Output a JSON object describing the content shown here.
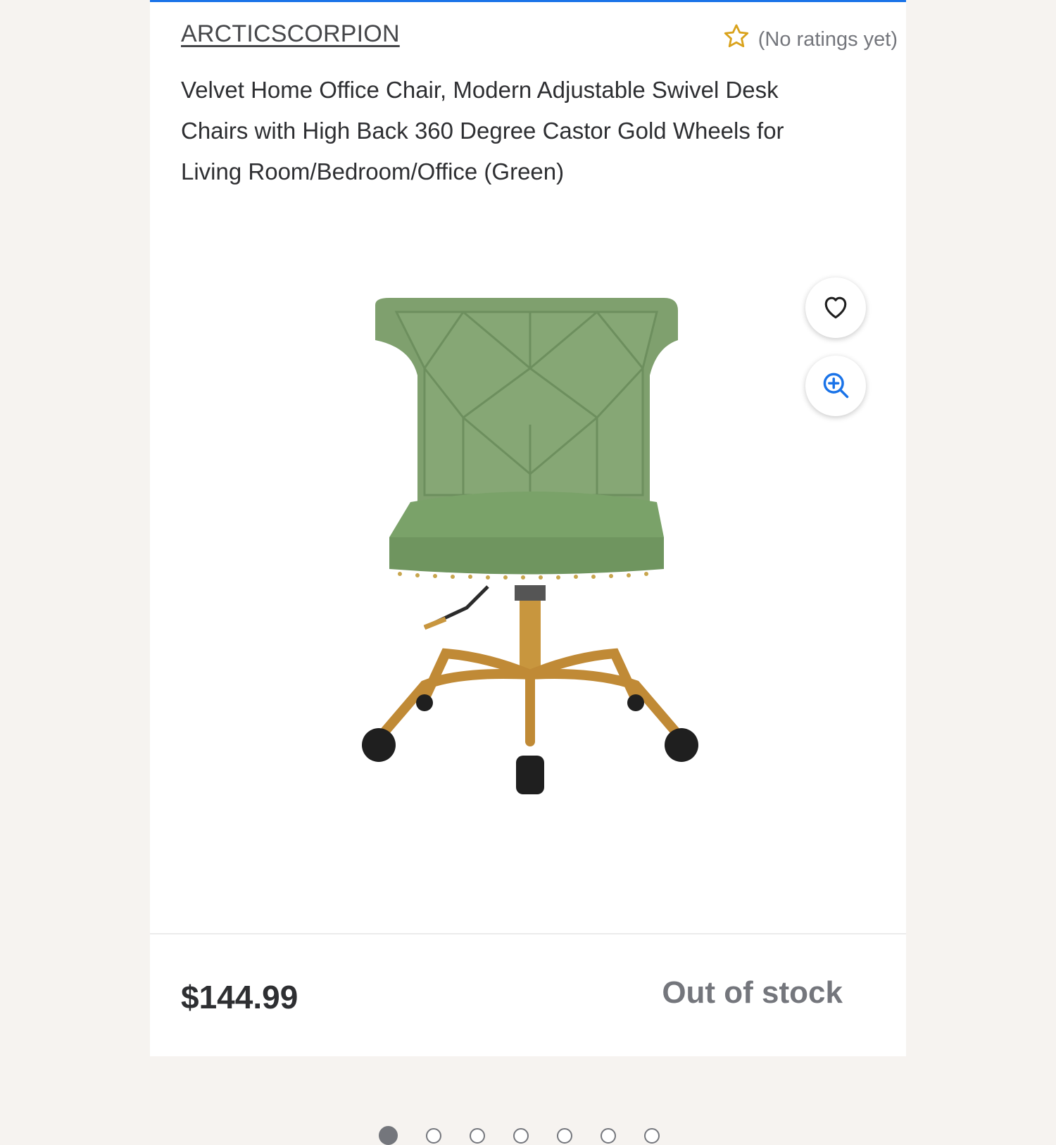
{
  "product": {
    "brand": "ARCTICSCORPION",
    "rating_text": "(No ratings yet)",
    "title": "Velvet Home Office Chair, Modern Adjustable Swivel Desk Chairs with High Back 360 Degree Castor Gold Wheels for Living Room/Bedroom/Office (Green)",
    "price": "$144.99",
    "availability": "Out of stock"
  },
  "gallery": {
    "image_count": 7,
    "active_index": 0
  },
  "icons": {
    "rating": "star-outline-icon",
    "favorite": "heart-outline-icon",
    "zoom": "zoom-in-icon"
  },
  "colors": {
    "accent_blue": "#1a73e8",
    "star_gold": "#d9a21b",
    "text_dark": "#2e2f32",
    "text_muted": "#74767c",
    "chair_green": "#7fa06e",
    "gold_metal": "#c8963e"
  }
}
